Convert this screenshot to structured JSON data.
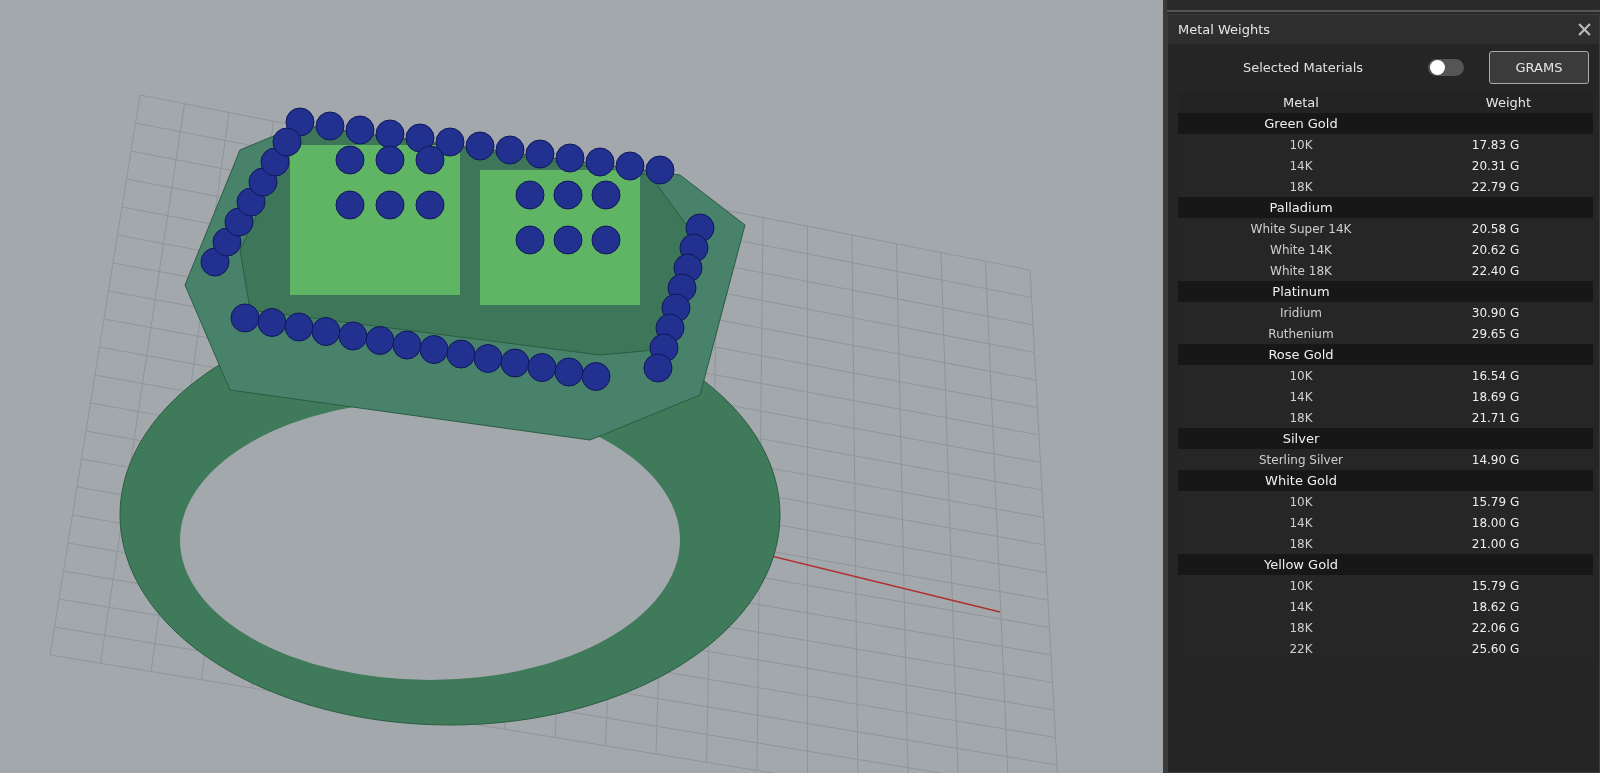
{
  "panel": {
    "title": "Metal Weights"
  },
  "selected_materials": {
    "label": "Selected Materials",
    "on": false
  },
  "unit_button": "GRAMS",
  "table": {
    "columns": [
      "Metal",
      "Weight"
    ],
    "groups": [
      {
        "name": "Green Gold",
        "items": [
          {
            "metal": "10K",
            "weight": "17.83 G"
          },
          {
            "metal": "14K",
            "weight": "20.31 G"
          },
          {
            "metal": "18K",
            "weight": "22.79 G"
          }
        ]
      },
      {
        "name": "Palladium",
        "items": [
          {
            "metal": "White Super 14K",
            "weight": "20.58 G"
          },
          {
            "metal": "White 14K",
            "weight": "20.62 G"
          },
          {
            "metal": "White 18K",
            "weight": "22.40 G"
          }
        ]
      },
      {
        "name": "Platinum",
        "items": [
          {
            "metal": "Iridium",
            "weight": "30.90 G"
          },
          {
            "metal": "Ruthenium",
            "weight": "29.65 G"
          }
        ]
      },
      {
        "name": "Rose Gold",
        "items": [
          {
            "metal": "10K",
            "weight": "16.54 G"
          },
          {
            "metal": "14K",
            "weight": "18.69 G"
          },
          {
            "metal": "18K",
            "weight": "21.71 G"
          }
        ]
      },
      {
        "name": "Silver",
        "items": [
          {
            "metal": "Sterling Silver",
            "weight": "14.90 G"
          }
        ]
      },
      {
        "name": "White Gold",
        "items": [
          {
            "metal": "10K",
            "weight": "15.79 G"
          },
          {
            "metal": "14K",
            "weight": "18.00 G"
          },
          {
            "metal": "18K",
            "weight": "21.00 G"
          }
        ]
      },
      {
        "name": "Yellow Gold",
        "items": [
          {
            "metal": "10K",
            "weight": "15.79 G"
          },
          {
            "metal": "14K",
            "weight": "18.62 G"
          },
          {
            "metal": "18K",
            "weight": "22.06 G"
          },
          {
            "metal": "22K",
            "weight": "25.60 G"
          }
        ]
      }
    ]
  }
}
